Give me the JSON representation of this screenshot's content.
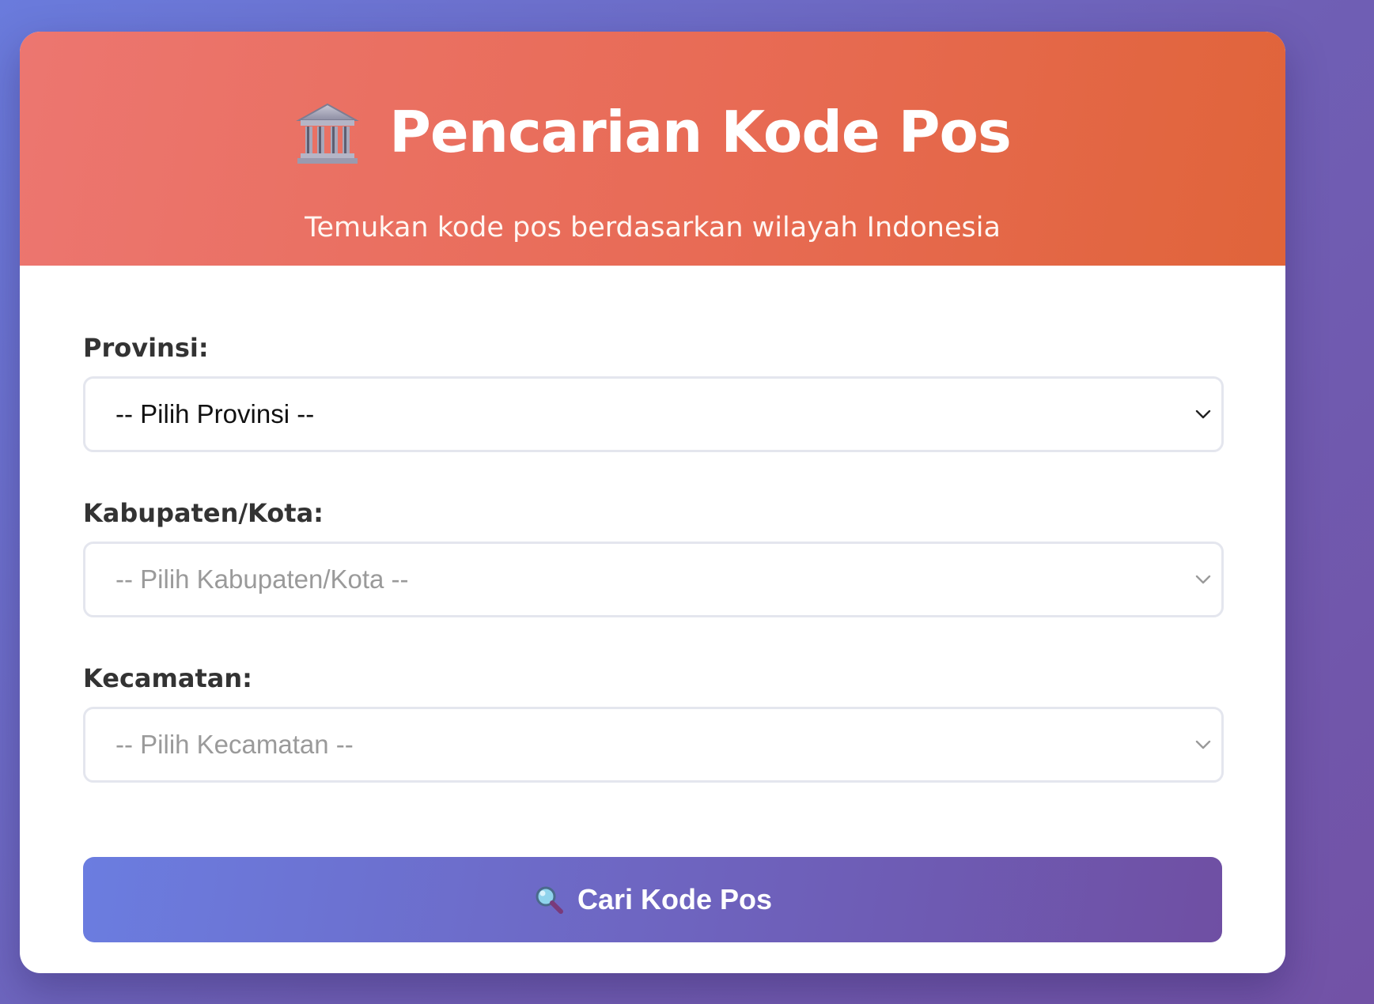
{
  "header": {
    "icon": "classical-building-icon",
    "title": "Pencarian Kode Pos",
    "subtitle": "Temukan kode pos berdasarkan wilayah Indonesia"
  },
  "form": {
    "province": {
      "label": "Provinsi:",
      "selected": "-- Pilih Provinsi --",
      "enabled": true
    },
    "regency": {
      "label": "Kabupaten/Kota:",
      "selected": "-- Pilih Kabupaten/Kota --",
      "enabled": false
    },
    "district": {
      "label": "Kecamatan:",
      "selected": "-- Pilih Kecamatan --",
      "enabled": false
    },
    "submit": {
      "icon": "magnifying-glass-icon",
      "label": "Cari Kode Pos"
    }
  },
  "colors": {
    "header_start": "#ec7670",
    "header_end": "#e0643a",
    "button_start": "#6b7de0",
    "button_end": "#6f4fa3",
    "background_start": "#6a7bdc",
    "background_end": "#7252a6"
  }
}
